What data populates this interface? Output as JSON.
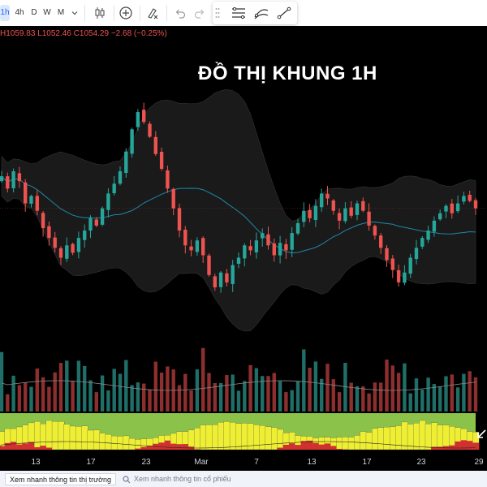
{
  "toolbar": {
    "timeframes": [
      {
        "label": "1h",
        "active": true
      },
      {
        "label": "4h",
        "active": false
      },
      {
        "label": "D",
        "active": false
      },
      {
        "label": "W",
        "active": false
      },
      {
        "label": "M",
        "active": false
      }
    ],
    "icons": [
      "chevron-down-icon",
      "candlestick-icon",
      "add-indicator-icon",
      "clear-drawings-icon",
      "undo-icon",
      "redo-icon"
    ],
    "floating_panel_icons": [
      "drag-handle-icon",
      "horizontal-lines-icon",
      "curve-lines-icon",
      "trendline-icon"
    ]
  },
  "ohlc": {
    "h_label": "H",
    "h_value": "1059.83",
    "l_label": "L",
    "l_value": "1052.46",
    "c_label": "C",
    "c_value": "1054.29",
    "change": "−2.68 (−0.25%)"
  },
  "chart_title": "ĐỒ THỊ KHUNG 1H",
  "time_axis": [
    "13",
    "17",
    "23",
    "Mar",
    "7",
    "13",
    "17",
    "23",
    "29"
  ],
  "footer": {
    "quick_market": "Xem nhanh thông tin thị trường",
    "quick_stock": "Xem nhanh thông tin cổ phiếu"
  },
  "colors": {
    "up": "#26a69a",
    "down": "#ef5350",
    "bb_band": "#1a1a1a",
    "basis": "#1e88a8",
    "background": "#000000",
    "indicator_green": "#8bc34a",
    "indicator_yellow": "#eeee33",
    "indicator_red": "#d32f2f"
  },
  "chart_data": {
    "type": "candlestick",
    "x_ticks": [
      "13",
      "17",
      "23",
      "Mar",
      "7",
      "13",
      "17",
      "23",
      "29"
    ],
    "close": [
      1069,
      1064,
      1071,
      1067,
      1058,
      1061,
      1055,
      1048,
      1044,
      1040,
      1036,
      1041,
      1038,
      1044,
      1047,
      1052,
      1049,
      1056,
      1062,
      1066,
      1071,
      1079,
      1088,
      1095,
      1091,
      1085,
      1078,
      1072,
      1064,
      1056,
      1047,
      1041,
      1039,
      1043,
      1037,
      1029,
      1024,
      1030,
      1026,
      1033,
      1036,
      1041,
      1039,
      1043,
      1046,
      1041,
      1037,
      1042,
      1039,
      1046,
      1050,
      1055,
      1052,
      1057,
      1062,
      1060,
      1055,
      1051,
      1056,
      1053,
      1058,
      1055,
      1049,
      1045,
      1040,
      1035,
      1031,
      1026,
      1030,
      1036,
      1040,
      1044,
      1047,
      1051,
      1054,
      1057,
      1054,
      1058,
      1061,
      1059,
      1056
    ],
    "ohlc_header": {
      "high": 1059.83,
      "low": 1052.46,
      "close": 1054.29,
      "change": -2.68,
      "change_pct": -0.25
    },
    "indicators": [
      "Bollinger Bands",
      "Volume",
      "oscillator (green/yellow/red bands)"
    ]
  }
}
